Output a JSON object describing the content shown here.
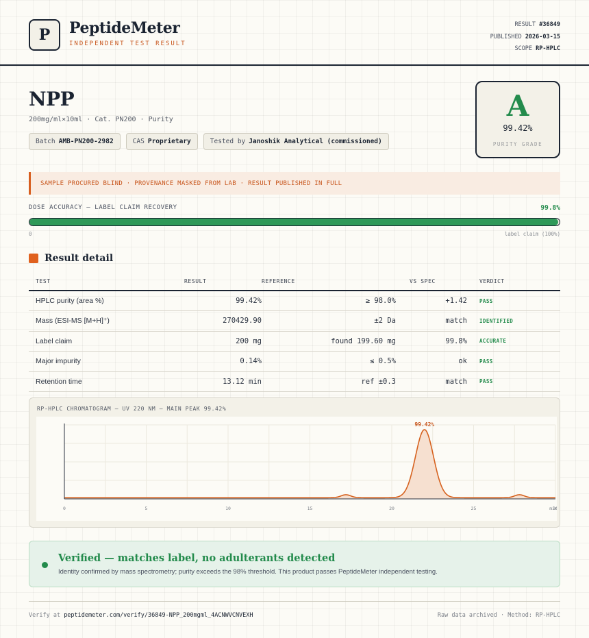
{
  "header": {
    "logo_letter": "P",
    "brand": "PeptideMeter",
    "brand_sub": "INDEPENDENT TEST RESULT",
    "result_label": "RESULT",
    "result_value": "#36849",
    "published_label": "PUBLISHED",
    "published_value": "2026-03-15",
    "scope_label": "SCOPE",
    "scope_value": "RP-HPLC"
  },
  "product": {
    "name": "NPP",
    "subline": "200mg/ml×10ml · Cat. PN200 · Purity",
    "chips": [
      {
        "label": "Batch",
        "value": "AMB-PN200-2982"
      },
      {
        "label": "CAS",
        "value": "Proprietary"
      },
      {
        "label": "Tested by",
        "value": "Janoshik Analytical (commissioned)"
      }
    ]
  },
  "grade": {
    "letter": "A",
    "value": "99.42%",
    "label": "PURITY GRADE",
    "color": "#238b4c"
  },
  "notice": "SAMPLE PROCURED BLIND · PROVENANCE MASKED FROM LAB · RESULT PUBLISHED IN FULL",
  "dose": {
    "label": "DOSE ACCURACY — LABEL CLAIM RECOVERY",
    "value_text": "99.8%",
    "fraction": 0.998,
    "min_label": "0",
    "max_label": "label claim (100%)"
  },
  "section_title": "Result detail",
  "table": {
    "headers": [
      "TEST",
      "RESULT",
      "REFERENCE",
      "VS SPEC",
      "VERDICT"
    ],
    "rows": [
      {
        "test": "HPLC purity (area %)",
        "result": "99.42%",
        "reference": "≥ 98.0%",
        "vs_spec": "+1.42",
        "verdict": "PASS"
      },
      {
        "test": "Mass (ESI-MS [M+H]⁺)",
        "result": "270429.90",
        "reference": "±2 Da",
        "vs_spec": "match",
        "verdict": "IDENTIFIED"
      },
      {
        "test": "Label claim",
        "result": "200 mg",
        "reference": "found 199.60 mg",
        "vs_spec": "99.8%",
        "verdict": "ACCURATE"
      },
      {
        "test": "Major impurity",
        "result": "0.14%",
        "reference": "≤ 0.5%",
        "vs_spec": "ok",
        "verdict": "PASS"
      },
      {
        "test": "Retention time",
        "result": "13.12 min",
        "reference": "ref ±0.3",
        "vs_spec": "match",
        "verdict": "PASS"
      }
    ]
  },
  "chart_data": {
    "type": "line",
    "title": "RP-HPLC CHROMATOGRAM — UV 220 NM — MAIN PEAK 99.42%",
    "xlabel": "",
    "ylabel": "",
    "x_unit_label": "min",
    "xlim": [
      0,
      30
    ],
    "ylim": [
      0,
      100
    ],
    "xticks": [
      0,
      5,
      10,
      15,
      20,
      25,
      30
    ],
    "grid": true,
    "baseline": 1.6,
    "peaks": [
      {
        "center": 17.2,
        "height": 4,
        "width": 0.3
      },
      {
        "center": 22.0,
        "height": 92,
        "width": 0.55
      },
      {
        "center": 27.8,
        "height": 4,
        "width": 0.3
      }
    ],
    "peak_annotation": {
      "x": 22.0,
      "text": "99.42%"
    },
    "line_color": "#d6621f",
    "fill_color": "#f6e0d0"
  },
  "verified": {
    "title": "Verified — matches label, no adulterants detected",
    "text": "Identity confirmed by mass spectrometry; purity exceeds the 98% threshold. This product passes PeptideMeter independent testing."
  },
  "footer": {
    "verify_prefix": "Verify at",
    "verify_url": "peptidemeter.com/verify/36849-NPP_200mgml_4ACNWVCNVEXH",
    "right": "Raw data archived · Method: RP-HPLC"
  }
}
